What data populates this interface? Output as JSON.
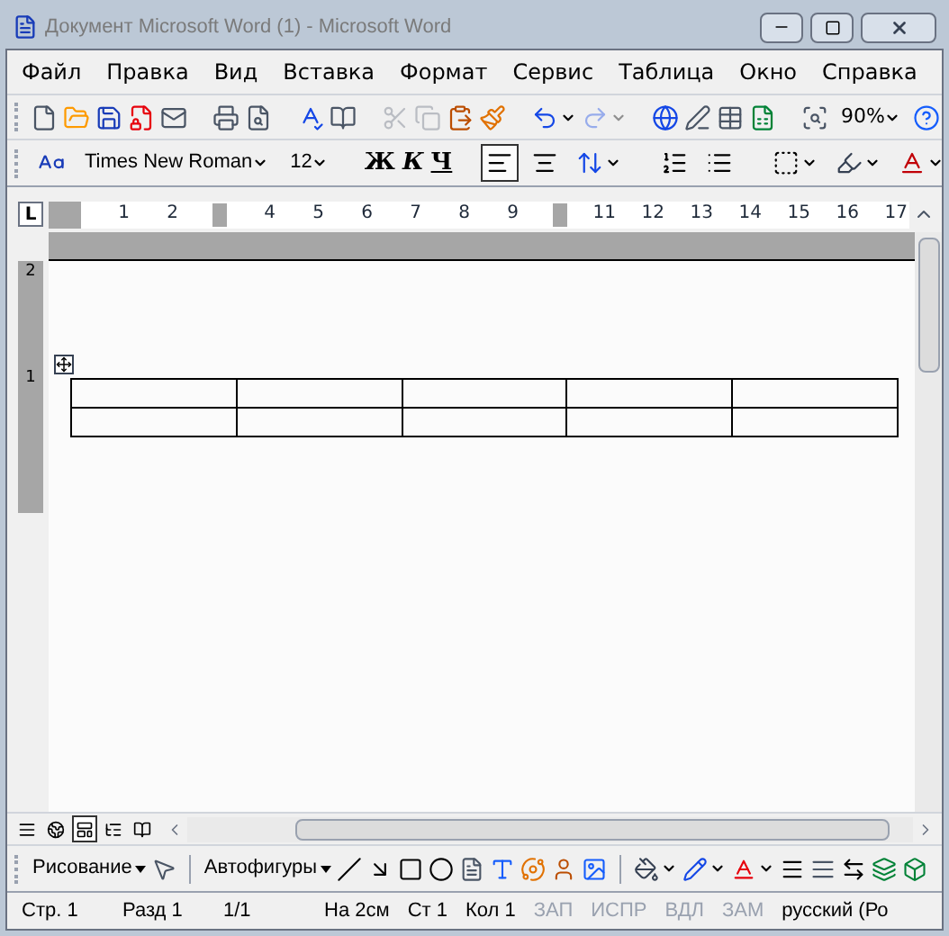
{
  "window": {
    "title": "Документ Microsoft Word (1) - Microsoft Word"
  },
  "menu": [
    "Файл",
    "Правка",
    "Вид",
    "Вставка",
    "Формат",
    "Сервис",
    "Таблица",
    "Окно",
    "Справка"
  ],
  "standard_toolbar": [
    {
      "kind": "button",
      "disabled": false
    },
    {
      "kind": "button",
      "disabled": false
    },
    {
      "kind": "button",
      "disabled": false
    },
    {
      "kind": "button",
      "disabled": false
    },
    {
      "kind": "button",
      "disabled": false
    },
    {
      "kind": "separator"
    },
    {
      "kind": "button",
      "disabled": false
    },
    {
      "kind": "button",
      "disabled": false
    },
    {
      "kind": "separator"
    },
    {
      "kind": "button",
      "disabled": false
    },
    {
      "kind": "button",
      "disabled": false
    },
    {
      "kind": "separator"
    },
    {
      "kind": "button",
      "disabled": true
    },
    {
      "kind": "button",
      "disabled": true
    },
    {
      "kind": "button",
      "disabled": false
    },
    {
      "kind": "button",
      "disabled": false
    },
    {
      "kind": "separator"
    },
    {
      "kind": "split",
      "disabled": false
    },
    {
      "kind": "split",
      "disabled": true
    },
    {
      "kind": "separator"
    },
    {
      "kind": "button",
      "disabled": false
    },
    {
      "kind": "button",
      "disabled": false
    },
    {
      "kind": "button",
      "disabled": false
    },
    {
      "kind": "button",
      "disabled": false
    },
    {
      "kind": "separator"
    },
    {
      "kind": "button",
      "disabled": false
    },
    {
      "kind": "field",
      "value": "90%"
    },
    {
      "kind": "button",
      "disabled": false
    }
  ],
  "formatting_toolbar": [
    {
      "kind": "button",
      "selected": false
    },
    {
      "kind": "field",
      "value": "Times New Roman"
    },
    {
      "kind": "field",
      "value": "12"
    },
    {
      "kind": "separator"
    },
    {
      "kind": "text",
      "label": "Ж"
    },
    {
      "kind": "text",
      "label": "К"
    },
    {
      "kind": "text",
      "label": "Ч"
    },
    {
      "kind": "separator"
    },
    {
      "kind": "button",
      "selected": true
    },
    {
      "kind": "button",
      "selected": false
    },
    {
      "kind": "split",
      "selected": false
    },
    {
      "kind": "separator"
    },
    {
      "kind": "button",
      "selected": false
    },
    {
      "kind": "button",
      "selected": false
    },
    {
      "kind": "separator"
    },
    {
      "kind": "split",
      "selected": false
    },
    {
      "kind": "split",
      "selected": false
    },
    {
      "kind": "split",
      "selected": false
    }
  ],
  "ruler": {
    "tab_selector": "L",
    "marks": [
      {
        "kind": "number",
        "label": "1"
      },
      {
        "kind": "number",
        "label": "2"
      },
      {
        "kind": "marker"
      },
      {
        "kind": "number",
        "label": "4"
      },
      {
        "kind": "number",
        "label": "5"
      },
      {
        "kind": "number",
        "label": "6"
      },
      {
        "kind": "number",
        "label": "7"
      },
      {
        "kind": "number",
        "label": "8"
      },
      {
        "kind": "number",
        "label": "9"
      },
      {
        "kind": "marker"
      },
      {
        "kind": "number",
        "label": "11"
      },
      {
        "kind": "number",
        "label": "12"
      },
      {
        "kind": "number",
        "label": "13"
      },
      {
        "kind": "number",
        "label": "14"
      },
      {
        "kind": "number",
        "label": "15"
      },
      {
        "kind": "number",
        "label": "16"
      },
      {
        "kind": "number",
        "label": "17"
      }
    ]
  },
  "vertical_ruler": [
    "2",
    "1"
  ],
  "table": {
    "rows": [
      {
        "cells": [
          {
            "kind": "empty"
          },
          {
            "kind": "empty"
          },
          {
            "kind": "empty"
          },
          {
            "kind": "empty"
          },
          {
            "kind": "empty"
          }
        ]
      },
      {
        "cells": [
          {
            "kind": "empty"
          },
          {
            "kind": "empty"
          },
          {
            "kind": "empty"
          },
          {
            "kind": "empty"
          },
          {
            "kind": "empty"
          }
        ]
      }
    ]
  },
  "view_buttons": [
    {
      "selected": false
    },
    {
      "selected": false
    },
    {
      "selected": true
    },
    {
      "selected": false
    },
    {
      "selected": false
    }
  ],
  "drawing_toolbar": [
    {
      "kind": "menu",
      "label": "Рисование"
    },
    {
      "kind": "button"
    },
    {
      "kind": "separator"
    },
    {
      "kind": "menu",
      "label": "Автофигуры"
    },
    {
      "kind": "button"
    },
    {
      "kind": "button"
    },
    {
      "kind": "button"
    },
    {
      "kind": "button"
    },
    {
      "kind": "button"
    },
    {
      "kind": "button"
    },
    {
      "kind": "button"
    },
    {
      "kind": "button"
    },
    {
      "kind": "button"
    },
    {
      "kind": "separator"
    },
    {
      "kind": "split"
    },
    {
      "kind": "split"
    },
    {
      "kind": "split"
    },
    {
      "kind": "button"
    },
    {
      "kind": "button"
    },
    {
      "kind": "button"
    },
    {
      "kind": "button"
    },
    {
      "kind": "button"
    }
  ],
  "status_bar": [
    {
      "label": "Стр. 1",
      "disabled": false
    },
    {
      "label": "Разд 1",
      "disabled": false
    },
    {
      "label": "1/1",
      "disabled": false
    },
    {
      "label": "На 2см",
      "disabled": false
    },
    {
      "label": "Ст 1",
      "disabled": false
    },
    {
      "label": "Кол 1",
      "disabled": false
    },
    {
      "label": "ЗАП",
      "disabled": true
    },
    {
      "label": "ИСПР",
      "disabled": true
    },
    {
      "label": "ВДЛ",
      "disabled": true
    },
    {
      "label": "ЗАМ",
      "disabled": true
    },
    {
      "label": "русский (Ро",
      "disabled": false
    }
  ]
}
